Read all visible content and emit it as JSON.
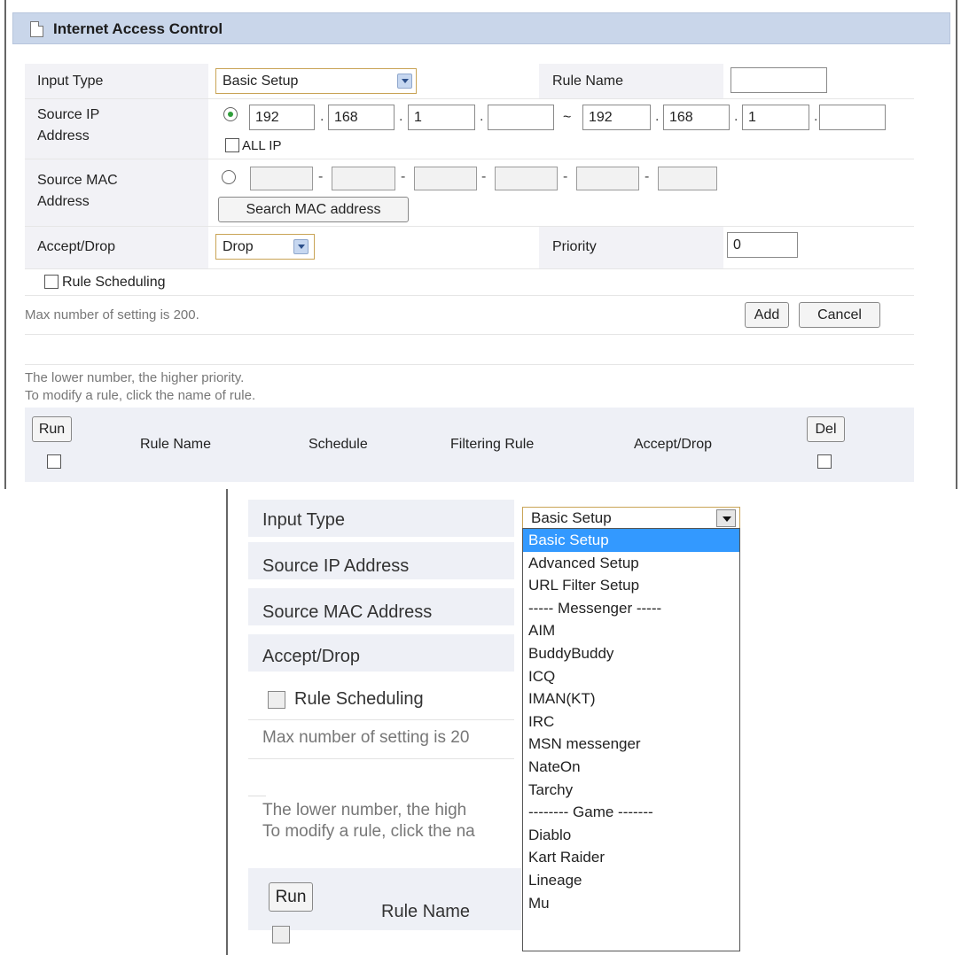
{
  "title": "Internet Access Control",
  "form": {
    "input_type": {
      "label": "Input Type",
      "value": "Basic Setup"
    },
    "rule_name": {
      "label": "Rule Name",
      "value": ""
    },
    "source_ip": {
      "label_line1": "Source IP",
      "label_line2": "Address",
      "start": [
        "192",
        "168",
        "1",
        ""
      ],
      "end": [
        "192",
        "168",
        "1",
        ""
      ],
      "range_sep": "~",
      "all_ip_label": "ALL IP"
    },
    "source_mac": {
      "label_line1": "Source MAC",
      "label_line2": "Address",
      "fields": [
        "",
        "",
        "",
        "",
        "",
        ""
      ],
      "search_button": "Search MAC address"
    },
    "accept_drop": {
      "label": "Accept/Drop",
      "value": "Drop"
    },
    "priority": {
      "label": "Priority",
      "value": "0"
    },
    "rule_scheduling": "Rule Scheduling",
    "max_note": "Max number of setting is 200.",
    "add_button": "Add",
    "cancel_button": "Cancel"
  },
  "notes": {
    "line1": "The lower number, the higher priority.",
    "line2": "To modify a rule, click the name of rule."
  },
  "list_header": {
    "run": "Run",
    "rule_name": "Rule Name",
    "schedule": "Schedule",
    "filtering_rule": "Filtering Rule",
    "accept_drop": "Accept/Drop",
    "del": "Del"
  },
  "zoom": {
    "input_type_label": "Input Type",
    "select_value": "Basic Setup",
    "source_ip_label": "Source IP Address",
    "source_mac_label": "Source MAC Address",
    "accept_drop_label": "Accept/Drop",
    "rule_scheduling": "Rule Scheduling",
    "max_note_partial": "Max number of setting is 20",
    "note1_partial": "The lower number, the high",
    "note2_partial": "To modify a rule, click the na",
    "run": "Run",
    "rule_name": "Rule Name",
    "options": [
      "Basic Setup",
      "Advanced Setup",
      "URL Filter Setup",
      "----- Messenger -----",
      "AIM",
      "BuddyBuddy",
      "ICQ",
      "IMAN(KT)",
      "IRC",
      "MSN messenger",
      "NateOn",
      "Tarchy",
      "-------- Game -------",
      "Diablo",
      "Kart Raider",
      "Lineage",
      "Mu"
    ]
  }
}
